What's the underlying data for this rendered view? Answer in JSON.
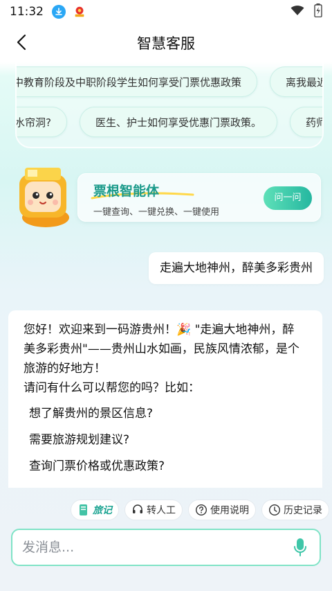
{
  "status": {
    "time": "11:32"
  },
  "header": {
    "title": "智慧客服"
  },
  "suggestions": {
    "row1": [
      "中教育阶段及中职阶段学生如何享受门票优惠政策",
      "离我最近"
    ],
    "row2": [
      "水帘洞?",
      "医生、护士如何享受优惠门票政策。",
      "药师"
    ]
  },
  "agent": {
    "name": "票根智能体",
    "tagline": "一键查询、一键兑换、一键使用",
    "button": "问一问"
  },
  "chat": {
    "user_message": "走遍大地神州，醉美多彩贵州",
    "bot_lines": [
      "您好！欢迎来到一码游贵州！🎉 \"走遍大地神州，醉",
      "美多彩贵州\"——贵州山水如画，民族风情浓郁，是个",
      "旅游的好地方！",
      "请问有什么可以帮您的吗？比如："
    ],
    "bot_items": [
      "想了解贵州的景区信息?",
      "需要旅游规划建议?",
      "查询门票价格或优惠政策?"
    ]
  },
  "quick_actions": {
    "travel": "旅记",
    "human": "转人工",
    "help": "使用说明",
    "history": "历史记录"
  },
  "input": {
    "placeholder": "发消息..."
  },
  "colors": {
    "accent": "#25b7a0",
    "accent_light": "#7fe3c6",
    "brand_text": "#1b9a8a"
  }
}
